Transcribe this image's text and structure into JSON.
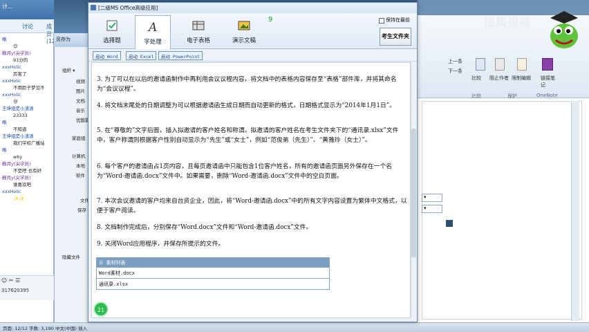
{
  "chat": {
    "header_left": "计...",
    "tabs": [
      "讨论",
      "成员(12"
    ],
    "messages": [
      {
        "user": "略",
        "text": ""
      },
      {
        "user": "",
        "text": "😊"
      },
      {
        "user": "静月y(尖学员)",
        "text": ""
      },
      {
        "user": "",
        "text": "91分的"
      },
      {
        "user": "xxxHolic",
        "text": ""
      },
      {
        "user": "",
        "text": "厉害了"
      },
      {
        "user": "xxxHolic",
        "text": ""
      },
      {
        "user": "",
        "text": "不用脸子梦见不"
      },
      {
        "user": "xxxHolic",
        "text": ""
      },
      {
        "user": "",
        "text": "😢"
      },
      {
        "user": "王坤组是小渣渣",
        "text": ""
      },
      {
        "user": "",
        "text": "23333"
      },
      {
        "user": "略",
        "text": ""
      },
      {
        "user": "",
        "text": "不知道"
      },
      {
        "user": "王坤组是小渣渣",
        "text": ""
      },
      {
        "user": "",
        "text": "我们学校广播站"
      },
      {
        "user": "略",
        "text": ""
      },
      {
        "user": "",
        "text": "why"
      },
      {
        "user": "静月y(尖学员)",
        "text": ""
      },
      {
        "user": "",
        "text": "不是吧  也有好"
      },
      {
        "user": "静月y(尖学员)",
        "text": ""
      },
      {
        "user": "",
        "text": "谁喜欢吧"
      },
      {
        "user": "xxxHolic",
        "text": ""
      },
      {
        "user": "",
        "text": "✨✨"
      }
    ],
    "bottom_icons": "☺ ✂ ☰",
    "bottom_id": "317620395"
  },
  "explorer": {
    "title": "另存为",
    "organize": "组织 ▾",
    "items": [
      "视频",
      "图片",
      "文档",
      "音乐",
      "优酷影",
      "家庭组",
      "计算机",
      "本地",
      "软件"
    ],
    "file_label": "文件",
    "save_label": "保存",
    "hide": "隐藏文件"
  },
  "word": {
    "ribbon_items": [
      "上一条",
      "下一条",
      "比较",
      "阻止作者",
      "限制编辑",
      "链接笔记",
      "比较",
      "保护",
      "OneNote"
    ],
    "status": "页面: 12/12   字数: 3,190   中文(中国)   插入"
  },
  "watermark": "搜狐视频",
  "dialog": {
    "title": "[二级MS Office高级应用]",
    "nav": [
      {
        "label": "选择题",
        "icon": "checkbox-icon"
      },
      {
        "label": "字处理",
        "icon": "text-a-icon"
      },
      {
        "label": "电子表格",
        "icon": "spreadsheet-icon"
      },
      {
        "label": "演示文稿",
        "icon": "slide-icon"
      }
    ],
    "counter": "9",
    "keep_on_top": "保持在最前",
    "examinee_folder": "考生文件夹",
    "launch_buttons": [
      "启动 Word",
      "启动 Excel",
      "启动 PowerPoint"
    ],
    "paragraphs": [
      "3. 为了可以在以后的邀请函制作中再利用会议议程内容，将文档中的表格内容保存至“表格”部件库，并将其命名为“会议议程”。",
      "4. 将文档末尾处的日期调整为可以根据邀请函生成日期而自动更新的格式，日期格式显示为“2014年1月1日”。",
      "5. 在“尊敬的”文字后面，插入拟邀请的客户姓名和称谓。拟邀请的客户姓名在考生文件夹下的“通讯录.xlsx”文件中，客户称谓则根据客户性别自动显示为“先生”或“女士”，例如“范俊弟（先生）”、“黄雅玲（女士）”。",
      "6. 每个客户的邀请函占1页内容，且每页邀请函中只能包含1位客户姓名，所有的邀请函页面另外保存在一个名为“Word-邀请函.docx”文件中。如果需要，删除“Word-邀请函.docx”文件中的空白页面。",
      "7. 本次会议邀请的客户均来自台资企业，因此，将“Word-邀请函.docx”中的所有文字内容设置为繁体中文格式，以便于客户阅读。",
      "8. 文档制作完成后，分别保存“Word.docx”文件和“Word-邀请函.docx”文件。",
      "9. 关闭Word应用程序，并保存所提示的文件。"
    ],
    "materials_header": "☰ 素材列表",
    "materials": [
      "Word素材.docx",
      "通讯录.xlsx"
    ],
    "page_number": "21"
  }
}
